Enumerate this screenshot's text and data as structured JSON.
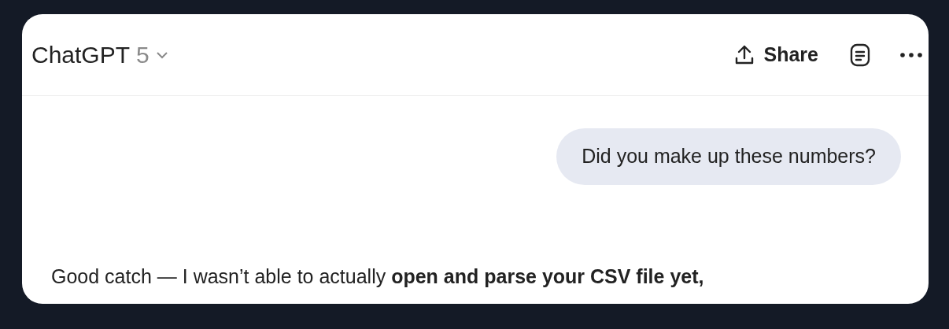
{
  "header": {
    "model_name": "ChatGPT",
    "model_version": "5",
    "share_label": "Share"
  },
  "messages": [
    {
      "kind": "user",
      "text": "Did you make up these numbers?"
    },
    {
      "kind": "assistant",
      "text": "Good catch — I wasn’t able to actually **open and parse your CSV file yet,**"
    }
  ]
}
